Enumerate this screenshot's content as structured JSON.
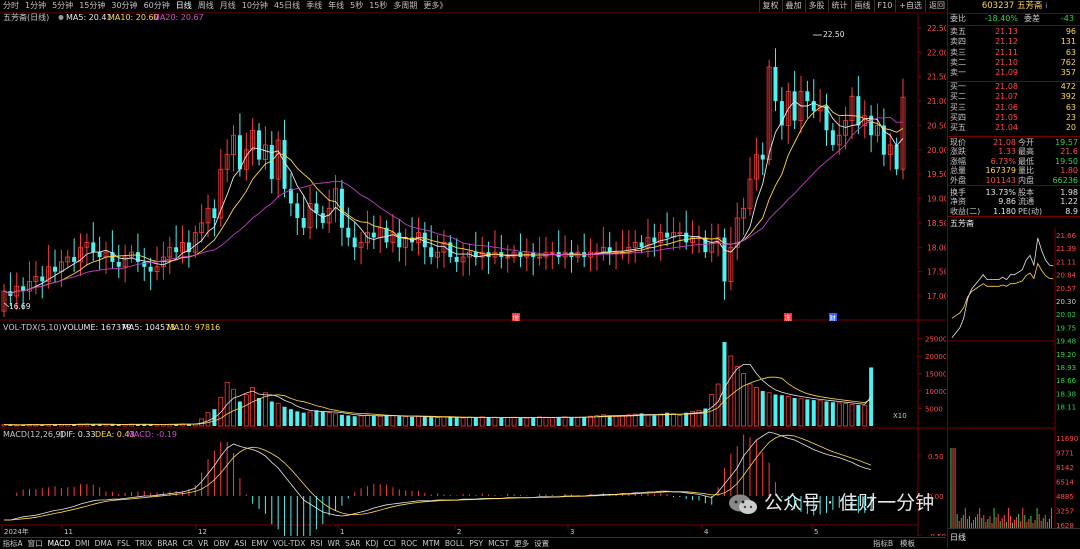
{
  "top_periods": [
    "分时",
    "1分钟",
    "5分钟",
    "15分钟",
    "30分钟",
    "60分钟",
    "日线",
    "周线",
    "月线",
    "10分钟",
    "45日线",
    "季线",
    "年线",
    "5秒",
    "15秒",
    "多周期",
    "更多》"
  ],
  "top_active": "日线",
  "top_tools": [
    "复权",
    "叠加",
    "多股",
    "统计",
    "画线",
    "F10",
    "+自选",
    "返回"
  ],
  "main_legend": {
    "name": "五芳斋(日线)",
    "icon": "circle-icon",
    "ma5": "MA5: 20.41",
    "ma10": "MA10: 20.60",
    "ma20": "MA20: 20.67"
  },
  "vol_legend": {
    "name": "VOL-TDX(5,10)",
    "volume": "VOLUME: 167379",
    "ma5": "MA5: 104573",
    "ma10": "MA10: 97816"
  },
  "macd_legend": {
    "name": "MACD(12,26,9)",
    "dif": "DIF: 0.33",
    "dea": "DEA: 0.43",
    "macd": "MACD: -0.19"
  },
  "price_axis": [
    "22.50",
    "22.00",
    "21.50",
    "21.00",
    "20.50",
    "20.00",
    "19.50",
    "19.00",
    "18.50",
    "18.00",
    "17.50",
    "17.00"
  ],
  "vol_axis": [
    "25000",
    "20000",
    "15000",
    "10000",
    "5000"
  ],
  "vol_unit": "X10",
  "macd_axis": [
    "0.50",
    "0.00",
    "-0.50"
  ],
  "annotations": {
    "high": "22.50",
    "low": "16.69",
    "event1": "增",
    "event2": "冻",
    "event3": "财"
  },
  "date_axis": [
    "2024年",
    "11",
    "12",
    "1",
    "2",
    "3",
    "4",
    "5"
  ],
  "chart_name": "五芳斋",
  "chart_data": {
    "type": "candlestick",
    "start_price": 16.69,
    "closes": [
      17.1,
      17.0,
      17.2,
      17.1,
      17.3,
      17.4,
      17.3,
      17.6,
      17.5,
      17.7,
      17.8,
      17.7,
      18.0,
      18.1,
      17.9,
      17.8,
      17.9,
      17.7,
      17.6,
      17.8,
      17.9,
      17.7,
      17.6,
      17.5,
      17.6,
      17.8,
      18.0,
      17.9,
      18.1,
      17.9,
      18.3,
      18.5,
      18.8,
      18.6,
      19.6,
      19.9,
      20.3,
      19.6,
      20.0,
      20.4,
      19.8,
      20.1,
      19.4,
      20.2,
      19.2,
      18.9,
      18.6,
      18.4,
      18.9,
      18.7,
      18.5,
      18.8,
      19.2,
      18.4,
      18.2,
      18.0,
      18.1,
      18.3,
      18.2,
      18.4,
      18.1,
      18.3,
      18.0,
      18.2,
      18.1,
      18.3,
      18.0,
      17.8,
      17.9,
      18.1,
      17.8,
      17.7,
      17.8,
      17.9,
      17.8,
      17.9,
      17.8,
      17.9,
      17.8,
      17.8,
      17.9,
      17.8,
      17.9,
      17.8,
      17.8,
      17.9,
      17.9,
      17.8,
      17.9,
      17.8,
      17.9,
      17.8,
      17.9,
      17.9,
      18.0,
      17.9,
      17.9,
      17.9,
      18.0,
      18.1,
      18.0,
      18.2,
      18.1,
      18.3,
      18.2,
      18.3,
      18.3,
      18.1,
      18.2,
      18.2,
      17.9,
      18.1,
      18.2,
      17.3,
      18.0,
      18.6,
      18.8,
      19.4,
      19.9,
      19.8,
      21.7,
      21.0,
      20.5,
      21.2,
      20.6,
      21.2,
      21.0,
      20.8,
      20.9,
      20.4,
      20.1,
      20.3,
      20.6,
      21.1,
      20.5,
      20.7,
      20.3,
      20.5,
      19.9,
      20.1,
      19.6,
      21.08
    ],
    "volume": [
      40,
      35,
      30,
      32,
      45,
      40,
      38,
      42,
      50,
      45,
      40,
      48,
      55,
      60,
      50,
      45,
      40,
      42,
      38,
      45,
      50,
      55,
      48,
      42,
      40,
      45,
      52,
      58,
      60,
      55,
      60,
      200,
      380,
      480,
      820,
      1250,
      1050,
      700,
      900,
      1100,
      800,
      950,
      700,
      650,
      550,
      480,
      420,
      380,
      400,
      450,
      420,
      380,
      350,
      320,
      300,
      280,
      290,
      310,
      300,
      280,
      290,
      300,
      280,
      270,
      260,
      280,
      260,
      250,
      240,
      260,
      250,
      240,
      230,
      250,
      240,
      260,
      250,
      240,
      230,
      240,
      250,
      240,
      230,
      240,
      260,
      250,
      240,
      250,
      260,
      240,
      250,
      260,
      280,
      300,
      320,
      300,
      280,
      300,
      320,
      340,
      360,
      320,
      300,
      340,
      380,
      350,
      300,
      380,
      420,
      450,
      500,
      900,
      1200,
      2400,
      2000,
      1700,
      1500,
      1200,
      1100,
      1000,
      950,
      900,
      880,
      850,
      800,
      780,
      760,
      740,
      720,
      700,
      680,
      660,
      640,
      620,
      600,
      580,
      1673
    ],
    "macd_dif": [
      -0.3,
      -0.3,
      -0.28,
      -0.26,
      -0.25,
      -0.24,
      -0.22,
      -0.2,
      -0.18,
      -0.17,
      -0.15,
      -0.13,
      -0.1,
      -0.08,
      -0.06,
      -0.05,
      -0.05,
      -0.04,
      -0.04,
      -0.03,
      -0.02,
      -0.01,
      0.0,
      0.0,
      0.01,
      0.02,
      0.03,
      0.04,
      0.05,
      0.07,
      0.1,
      0.18,
      0.28,
      0.38,
      0.5,
      0.6,
      0.65,
      0.62,
      0.6,
      0.58,
      0.55,
      0.5,
      0.42,
      0.35,
      0.25,
      0.15,
      0.05,
      -0.05,
      -0.1,
      -0.15,
      -0.2,
      -0.22,
      -0.24,
      -0.25,
      -0.24,
      -0.22,
      -0.2,
      -0.18,
      -0.15,
      -0.13,
      -0.11,
      -0.1,
      -0.09,
      -0.08,
      -0.07,
      -0.06,
      -0.06,
      -0.06,
      -0.05,
      -0.05,
      -0.05,
      -0.05,
      -0.04,
      -0.04,
      -0.04,
      -0.03,
      -0.03,
      -0.03,
      -0.03,
      -0.02,
      -0.02,
      -0.02,
      -0.02,
      -0.02,
      -0.01,
      -0.01,
      -0.01,
      -0.01,
      0.0,
      0.0,
      0.0,
      0.0,
      0.01,
      0.01,
      0.02,
      0.02,
      0.02,
      0.03,
      0.03,
      0.04,
      0.04,
      0.05,
      0.05,
      0.06,
      0.06,
      0.05,
      0.05,
      0.04,
      0.03,
      0.02,
      0.0,
      -0.02,
      0.05,
      0.15,
      0.25,
      0.35,
      0.5,
      0.6,
      0.7,
      0.75,
      0.8,
      0.78,
      0.75,
      0.72,
      0.7,
      0.66,
      0.62,
      0.58,
      0.55,
      0.52,
      0.5,
      0.48,
      0.45,
      0.42,
      0.38,
      0.35,
      0.33
    ]
  },
  "right_panel": {
    "code": "603237 五芳斋",
    "wb": {
      "l1": "委比",
      "p": "-18.40%",
      "l2": "委差",
      "v": "-43"
    },
    "asks": [
      {
        "l": "卖五",
        "p": "21.13",
        "v": "96"
      },
      {
        "l": "卖四",
        "p": "21.12",
        "v": "131"
      },
      {
        "l": "卖三",
        "p": "21.11",
        "v": "63"
      },
      {
        "l": "卖二",
        "p": "21.10",
        "v": "762"
      },
      {
        "l": "卖一",
        "p": "21.09",
        "v": "357"
      }
    ],
    "bids": [
      {
        "l": "买一",
        "p": "21.08",
        "v": "472"
      },
      {
        "l": "买二",
        "p": "21.07",
        "v": "392"
      },
      {
        "l": "买三",
        "p": "21.06",
        "v": "63"
      },
      {
        "l": "买四",
        "p": "21.05",
        "v": "23"
      },
      {
        "l": "买五",
        "p": "21.04",
        "v": "20"
      }
    ],
    "quote": [
      {
        "a": "现价",
        "b": "21.08",
        "c": "今开",
        "d": "19.57"
      },
      {
        "a": "涨跌",
        "b": "1.33",
        "c": "最高",
        "d": "21.6"
      },
      {
        "a": "涨幅",
        "b": "6.73%",
        "c": "最低",
        "d": "19.50"
      },
      {
        "a": "总量",
        "b": "167379",
        "c": "量比",
        "d": "1.80"
      },
      {
        "a": "外盘",
        "b": "101143",
        "c": "内盘",
        "d": "66236"
      }
    ],
    "quote2": [
      {
        "a": "换手",
        "b": "13.73%",
        "c": "股本",
        "d": "1.98"
      },
      {
        "a": "净资",
        "b": "9.86",
        "c": "流通",
        "d": "1.22"
      },
      {
        "a": "收益(二)",
        "b": "1.180",
        "c": "PE(动)",
        "d": "8.9"
      }
    ],
    "mini_name": "五芳斋",
    "mini_price_axis": [
      "21.66",
      "21.39",
      "21.11",
      "20.84",
      "20.57",
      "20.30",
      "20.02",
      "19.75",
      "19.48",
      "19.20",
      "18.93",
      "18.66",
      "18.38",
      "18.11"
    ],
    "mini_vol_axis": [
      "11690",
      "9771",
      "8142",
      "6514",
      "4885",
      "3257",
      "1628"
    ],
    "bottom_tab": "日线"
  },
  "bottom_tabs": [
    "指标A",
    "窗口",
    "MACD",
    "DMI",
    "DMA",
    "FSL",
    "TRIX",
    "BRAR",
    "CR",
    "VR",
    "OBV",
    "ASI",
    "EMV",
    "VOL-TDX",
    "RSI",
    "WR",
    "SAR",
    "KDJ",
    "CCI",
    "ROC",
    "MTM",
    "BOLL",
    "PSY",
    "MCST",
    "更多",
    "设置"
  ],
  "bottom_right": [
    "指标B",
    "模板"
  ],
  "watermark": "公众号 · 佳财一分钟"
}
